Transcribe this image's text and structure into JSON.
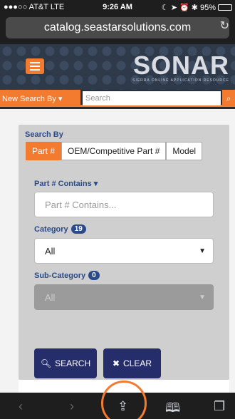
{
  "status": {
    "carrier": "●●●○○ AT&T  LTE",
    "time": "9:26 AM",
    "battery": "95%"
  },
  "browser": {
    "url": "catalog.seastarsolutions.com"
  },
  "header": {
    "logo": "SONAR",
    "tagline": "SIERRA ONLINE APPLICATION RESOURCE"
  },
  "searchbar": {
    "button_label": "New Search By ▾",
    "placeholder": "Search"
  },
  "panel": {
    "title": "Search By",
    "tabs": [
      {
        "label": "Part #"
      },
      {
        "label": "OEM/Competitive Part #"
      },
      {
        "label": "Model"
      }
    ],
    "part_label": "Part # Contains ▾",
    "part_placeholder": "Part # Contains...",
    "category_label": "Category",
    "category_count": "19",
    "category_value": "All",
    "subcategory_label": "Sub-Category",
    "subcategory_count": "0",
    "subcategory_value": "All",
    "search_button": "SEARCH",
    "clear_button": "CLEAR"
  },
  "colors": {
    "accent": "#f27b2f",
    "navy": "#252e6a",
    "label": "#2a4b8a"
  }
}
